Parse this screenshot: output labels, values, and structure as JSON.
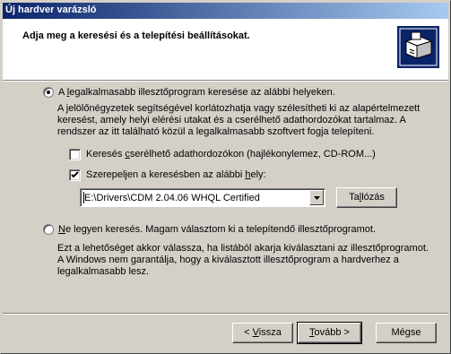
{
  "window": {
    "title": "Új hardver varázsló"
  },
  "header": {
    "title": "Adja meg a keresési és a telepítési beállításokat."
  },
  "option_search": {
    "label_pre": "A ",
    "label_accel": "l",
    "label_post": "egalkalmasabb illesztőprogram keresése az alábbi helyeken.",
    "selected": true,
    "description": "A jelölőnégyzetek segítségével korlátozhatja vagy szélesítheti ki az alapértelmezett keresést, amely helyi elérési utakat és a cserélhető adathordozókat tartalmaz. A rendszer az itt található közül a legalkalmasabb szoftvert fogja telepíteni.",
    "removable": {
      "label_pre": "Keresés ",
      "label_accel": "c",
      "label_post": "serélhető adathordozókon (hajlékonylemez, CD-ROM...)",
      "checked": false
    },
    "include_location": {
      "label_pre": "Szerepeljen a keresésben az alábbi ",
      "label_accel": "h",
      "label_post": "ely:",
      "checked": true
    },
    "path_value": "E:\\Drivers\\CDM 2.04.06 WHQL Certified",
    "browse_button": {
      "pre": "Ta",
      "accel": "l",
      "post": "lózás"
    }
  },
  "option_nosearch": {
    "label_pre": "",
    "label_accel": "N",
    "label_post": "e legyen keresés. Magam választom ki a telepítendő illesztőprogramot.",
    "selected": false,
    "description": "Ezt a lehetőséget akkor válassza, ha listából akarja kiválasztani az illesztőprogramot. A Windows nem garantálja, hogy a kiválasztott illesztőprogram a hardverhez a legalkalmasabb lesz."
  },
  "footer": {
    "back": {
      "pre": "< ",
      "accel": "V",
      "post": "issza"
    },
    "next": {
      "pre": "",
      "accel": "T",
      "post": "ovább >"
    },
    "cancel": "Mégse"
  }
}
